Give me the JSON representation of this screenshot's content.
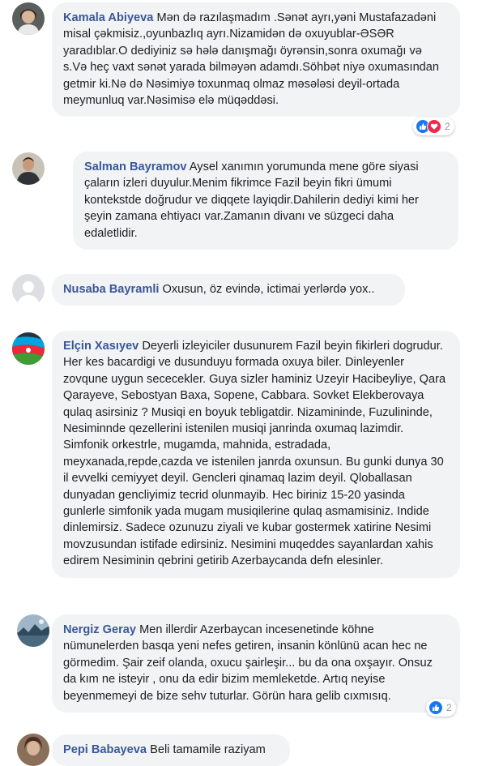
{
  "comments": [
    {
      "author": "Kamala Abiyeva",
      "text": "Mən də razılaşmadım .Sənət ayrı,yəni Mustafazadəni misal çəkmisiz.,oyunbazlıq ayrı.Nizamidən də oxuyublar-ƏSƏR yaradıblar.O dediyiniz sə hələ danışmağı öyrənsin,sonra oxumağı və s.Və heç vaxt sənət yarada bilməyən adamdı.Söhbət niyə oxumasından getmir ki.Nə də Nəsimiyə toxunmaq olmaz məsələsi deyil-ortada meymunluq var.Nəsimisə elə müqəddəsi.",
      "reactions": [
        "like",
        "love"
      ],
      "reaction_count": "2"
    },
    {
      "author": "Salman Bayramov",
      "text": "Aysel xanımın yorumunda mene göre siyasi çaların izleri duyulur.Menim fikrimce Fazil beyin fikri ümumi kontekstde doğrudur ve diqqete layiqdir.Dahilerin dediyi kimi her şeyin zamana ehtiyacı var.Zamanın divanı ve süzgeci daha edaletlidir."
    },
    {
      "author": "Nusaba Bayramli",
      "text": "Oxusun, öz evində, ictimai yerlərdə yox.."
    },
    {
      "author": "Elçin Xasıyev",
      "text": "Deyerli izleyiciler dusunurem Fazil beyin fikirleri dogrudur. Her kes bacardigi ve dusunduyu formada oxuya biler. Dinleyenler zovqune uygun sececekler. Guya sizler haminiz Uzeyir Hacibeyliye, Qara Qarayeve, Sebostyan Baxa, Sopene, Cabbara. Sovket Elekberovaya qulaq asirsiniz ? Musiqi en boyuk tebligatdir. Nizamininde, Fuzulininde, Nesiminnde qezellerini istenilen musiqi janrinda oxumaq lazimdir. Simfonik orkestrle, mugamda, mahnida, estradada, meyxanada,repde,cazda ve istenilen janrda oxunsun. Bu gunki dunya 30 il evvelki cemiyyet deyil. Gencleri qinamaq lazim deyil. Qloballasan dunyadan gencliyimiz tecrid olunmayib. Hec biriniz 15-20 yasinda gunlerle simfonik yada mugam musiqilerine qulaq asmamisiniz. Indide dinlemirsiz. Sadece ozunuzu ziyali ve kubar gostermek xatirine Nesimi movzusundan istifade edirsiniz. Nesimini muqeddes sayanlardan xahis edirem Nesiminin qebrini getirib Azerbaycanda defn elesinler."
    },
    {
      "author": "Nergiz Geray",
      "text": "Men illerdir Azerbaycan incesenetinde köhne nümunelerden basqa yeni nefes getiren, insanin könlünü acan hec ne görmedim. Şair zeif olanda, oxucu şairleşir... bu da ona oxşayır. Onsuz da kım ne isteyir , onu da edir bizim memleketde. Artıq neyise beyenmemeyi de bize sehv tuturlar. Görün hara gelib cıxmısıq.",
      "reactions": [
        "like"
      ],
      "reaction_count": "2"
    },
    {
      "author": "Pepi Babayeva",
      "text": "Beli tamamile raziyam"
    }
  ],
  "colors": {
    "author": "#385898",
    "bubble": "#f2f3f5",
    "text": "#1c1e21",
    "like": "#1877f2",
    "love": "#f0284a"
  }
}
